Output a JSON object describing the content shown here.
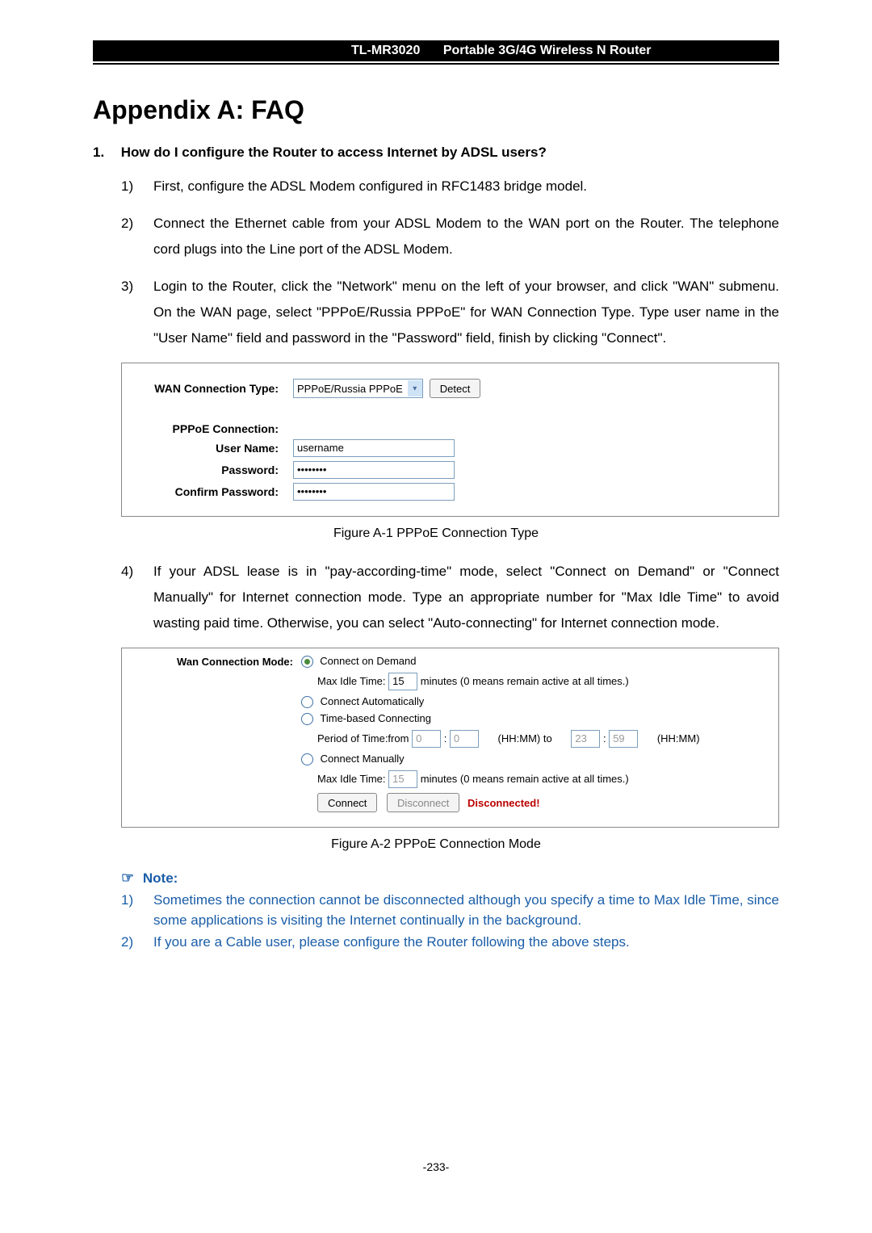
{
  "header": {
    "model": "TL-MR3020",
    "desc": "Portable 3G/4G Wireless N Router"
  },
  "title": "Appendix A: FAQ",
  "q1": {
    "num": "1.",
    "text": "How do I configure the Router to access Internet by ADSL users?"
  },
  "steps": {
    "s1": "First, configure the ADSL Modem configured in RFC1483 bridge model.",
    "s2": "Connect the Ethernet cable from your ADSL Modem to the WAN port on the Router. The telephone cord plugs into the Line port of the ADSL Modem.",
    "s3": "Login to the Router, click the \"Network\" menu on the left of your browser, and click \"WAN\" submenu. On the WAN page, select \"PPPoE/Russia PPPoE\" for WAN Connection Type. Type user name in the \"User Name\" field and password in the \"Password\" field, finish by clicking \"Connect\".",
    "s4": "If your ADSL lease is in \"pay-according-time\" mode, select \"Connect on Demand\" or \"Connect Manually\" for Internet connection mode. Type an appropriate number for \"Max Idle Time\" to avoid wasting paid time. Otherwise, you can select \"Auto-connecting\" for Internet connection mode."
  },
  "fig1": {
    "wan_type_label": "WAN Connection Type:",
    "wan_type_value": "PPPoE/Russia PPPoE",
    "detect_label": "Detect",
    "pppoe_conn_label": "PPPoE Connection:",
    "username_label": "User Name:",
    "username_value": "username",
    "password_label": "Password:",
    "password_value": "••••••••",
    "confirm_label": "Confirm Password:",
    "confirm_value": "••••••••",
    "caption": "Figure A-1   PPPoE Connection Type"
  },
  "fig2": {
    "mode_label": "Wan Connection Mode:",
    "opt_demand": "Connect on Demand",
    "max_idle_label": "Max Idle Time:",
    "max_idle_1": "15",
    "max_idle_unit": "minutes (0 means remain active at all times.)",
    "opt_auto": "Connect Automatically",
    "opt_time": "Time-based Connecting",
    "period_label": "Period of Time:from",
    "t_from_h": "0",
    "t_from_m": "0",
    "hhmm_to": "(HH:MM) to",
    "t_to_h": "23",
    "t_to_m": "59",
    "hhmm": "(HH:MM)",
    "opt_manual": "Connect Manually",
    "max_idle_2": "15",
    "connect_btn": "Connect",
    "disconnect_btn": "Disconnect",
    "status": "Disconnected!",
    "caption": "Figure A-2   PPPoE Connection Mode"
  },
  "note": {
    "heading": "Note:",
    "n1": "Sometimes the connection cannot be disconnected although you specify a time to Max Idle Time, since some applications is visiting the Internet continually in the background.",
    "n2": "If you are a Cable user, please configure the Router following the above steps."
  },
  "pagenum": "-233-"
}
